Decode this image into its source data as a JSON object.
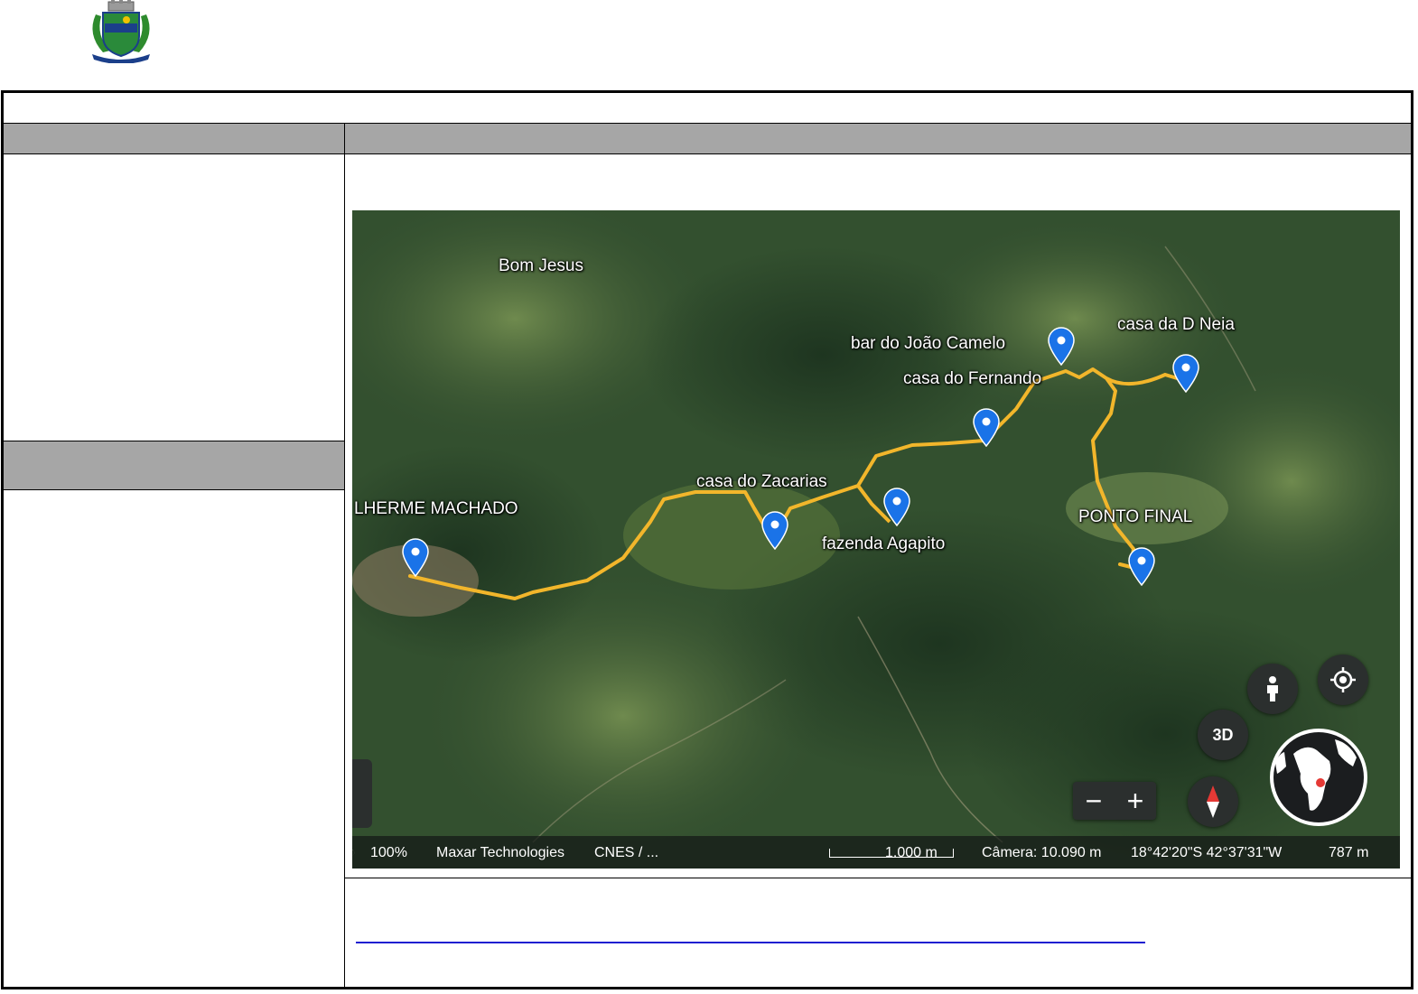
{
  "map": {
    "labels": {
      "bom_jesus": "Bom Jesus",
      "bar_joao_camelo": "bar do João Camelo",
      "casa_d_neia": "casa da D Neia",
      "casa_fernando": "casa do Fernando",
      "casa_zacarias": "casa do Zacarias",
      "guilherme_machado": "LHERME MACHADO",
      "ponto_final": "PONTO FINAL",
      "fazenda_agapito": "fazenda Agapito"
    },
    "controls": {
      "btn_3d": "3D",
      "zoom_out": "−",
      "zoom_in": "+"
    },
    "status": {
      "zoom": "100%",
      "imagery": "Maxar Technologies",
      "cnes": "CNES / ...",
      "scale": "1.000 m",
      "camera": "Câmera: 10.090 m",
      "coords": "18°42'20\"S 42°37'31\"W",
      "elevation": "787 m"
    },
    "colors": {
      "route": "#f2b62b",
      "pin": "#1a73e8"
    }
  }
}
